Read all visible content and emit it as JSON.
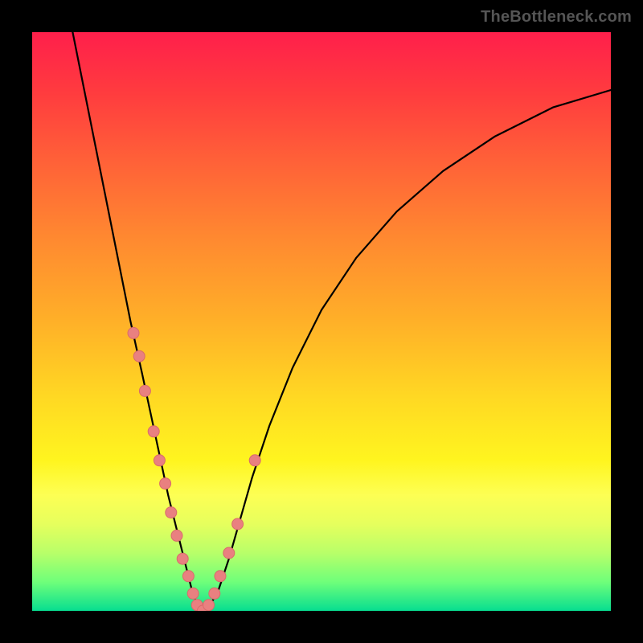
{
  "watermark": "TheBottleneck.com",
  "chart_data": {
    "type": "line",
    "title": "",
    "xlabel": "",
    "ylabel": "",
    "xlim": [
      0,
      100
    ],
    "ylim": [
      0,
      100
    ],
    "grid": false,
    "legend": false,
    "background": "gradient-red-green",
    "series": [
      {
        "name": "bottleneck-curve",
        "x": [
          7,
          9,
          11,
          13,
          15,
          17,
          19,
          20.5,
          22,
          23.5,
          25,
          26.5,
          27.5,
          28.5,
          30,
          32,
          34,
          36,
          38,
          41,
          45,
          50,
          56,
          63,
          71,
          80,
          90,
          100
        ],
        "y": [
          100,
          90,
          80,
          70,
          60,
          50,
          41,
          34,
          27,
          20,
          14,
          8,
          4,
          1,
          0,
          3,
          9,
          16,
          23,
          32,
          42,
          52,
          61,
          69,
          76,
          82,
          87,
          90
        ]
      }
    ],
    "points": {
      "name": "sample-markers",
      "color": "#e98080",
      "x": [
        17.5,
        18.5,
        19.5,
        21.0,
        22.0,
        23.0,
        24.0,
        25.0,
        26.0,
        27.0,
        27.8,
        28.5,
        29.5,
        30.5,
        31.5,
        32.5,
        34.0,
        35.5,
        38.5
      ],
      "y": [
        48,
        44,
        38,
        31,
        26,
        22,
        17,
        13,
        9,
        6,
        3,
        1,
        0,
        1,
        3,
        6,
        10,
        15,
        26
      ]
    }
  }
}
